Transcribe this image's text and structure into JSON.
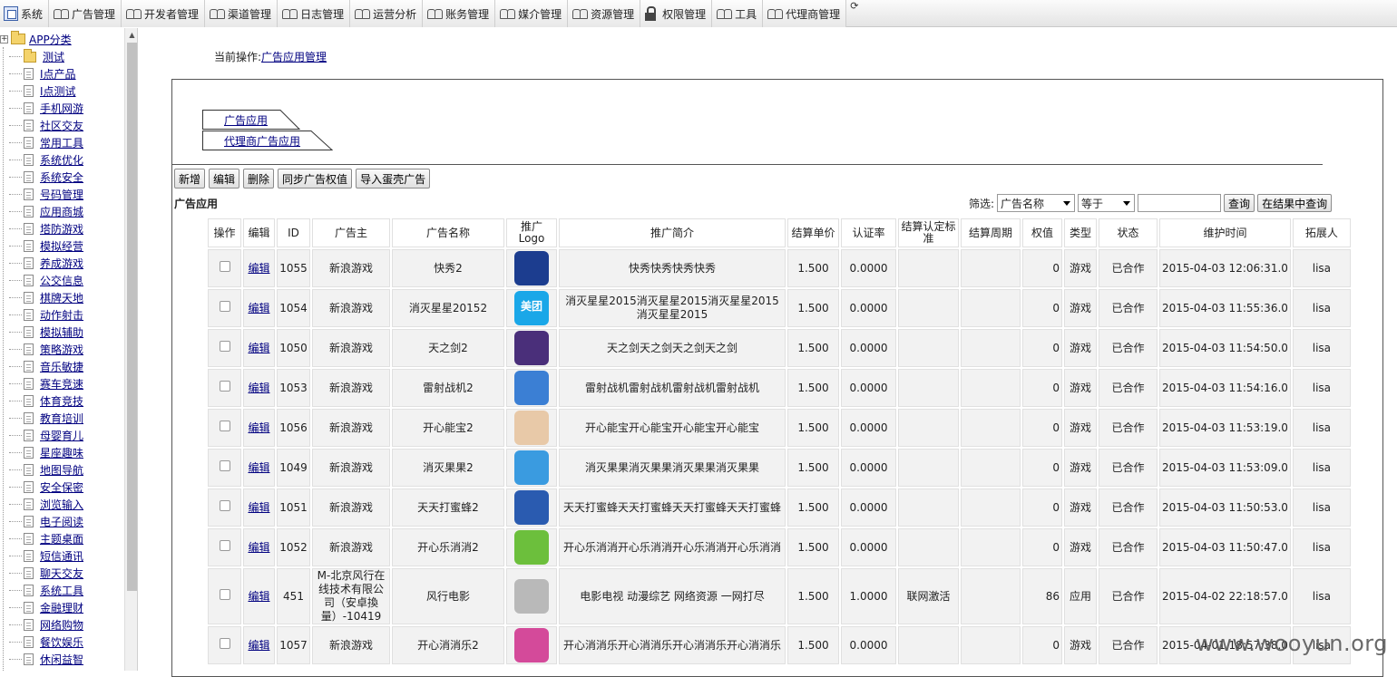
{
  "menu": [
    {
      "label": "系统",
      "icon": "system-icon",
      "kind": "sys"
    },
    {
      "label": "广告管理",
      "icon": "people-icon",
      "kind": "people"
    },
    {
      "label": "开发者管理",
      "icon": "people-icon",
      "kind": "people"
    },
    {
      "label": "渠道管理",
      "icon": "people-icon",
      "kind": "people"
    },
    {
      "label": "日志管理",
      "icon": "people-icon",
      "kind": "people"
    },
    {
      "label": "运营分析",
      "icon": "people-icon",
      "kind": "people"
    },
    {
      "label": "账务管理",
      "icon": "people-icon",
      "kind": "people"
    },
    {
      "label": "媒介管理",
      "icon": "people-icon",
      "kind": "people"
    },
    {
      "label": "资源管理",
      "icon": "people-icon",
      "kind": "people"
    },
    {
      "label": "权限管理",
      "icon": "lock-icon",
      "kind": "lock"
    },
    {
      "label": "工具",
      "icon": "people-icon",
      "kind": "people"
    },
    {
      "label": "代理商管理",
      "icon": "people-icon",
      "kind": "people"
    }
  ],
  "tree": {
    "root_expander": "+",
    "root": "APP分类",
    "items": [
      "测试",
      "I点产品",
      "I点测试",
      "手机网游",
      "社区交友",
      "常用工具",
      "系统优化",
      "系统安全",
      "号码管理",
      "应用商城",
      "塔防游戏",
      "模拟经营",
      "养成游戏",
      "公交信息",
      "棋牌天地",
      "动作射击",
      "模拟辅助",
      "策略游戏",
      "音乐敏捷",
      "赛车竞速",
      "体育竞技",
      "教育培训",
      "母婴育儿",
      "星座趣味",
      "地图导航",
      "安全保密",
      "浏览输入",
      "电子阅读",
      "主题桌面",
      "短信通讯",
      "聊天交友",
      "系统工具",
      "金融理财",
      "网络购物",
      "餐饮娱乐",
      "休闲益智"
    ]
  },
  "breadcrumb": {
    "prefix": "当前操作:",
    "link": "广告应用管理"
  },
  "tabs": [
    "广告应用",
    "代理商广告应用"
  ],
  "toolbar": [
    "新增",
    "编辑",
    "删除",
    "同步广告权值",
    "导入蛋壳广告"
  ],
  "section_title": "广告应用",
  "filter": {
    "label": "筛选:",
    "field": "广告名称",
    "op": "等于",
    "value": "",
    "search": "查询",
    "search_in_results": "在结果中查询"
  },
  "columns": [
    "操作",
    "编辑",
    "ID",
    "广告主",
    "广告名称",
    "推广Logo",
    "推广简介",
    "结算单价",
    "认证率",
    "结算认定标准",
    "结算周期",
    "权值",
    "类型",
    "状态",
    "维护时间",
    "拓展人"
  ],
  "rows": [
    {
      "edit": "编辑",
      "id": "1055",
      "advertiser": "新浪游戏",
      "name": "快秀2",
      "logo": {
        "text": "",
        "color": "#1c3d8f"
      },
      "intro": "快秀快秀快秀快秀",
      "price": "1.500",
      "rate": "0.0000",
      "standard": "",
      "cycle": "",
      "weight": "0",
      "type": "游戏",
      "status": "已合作",
      "time": "2015-04-03 12:06:31.0",
      "owner": "lisa"
    },
    {
      "edit": "编辑",
      "id": "1054",
      "advertiser": "新浪游戏",
      "name": "消灭星星20152",
      "logo": {
        "text": "美团",
        "color": "#1aa7e8"
      },
      "intro": "消灭星星2015消灭星星2015消灭星星2015消灭星星2015",
      "price": "1.500",
      "rate": "0.0000",
      "standard": "",
      "cycle": "",
      "weight": "0",
      "type": "游戏",
      "status": "已合作",
      "time": "2015-04-03 11:55:36.0",
      "owner": "lisa"
    },
    {
      "edit": "编辑",
      "id": "1050",
      "advertiser": "新浪游戏",
      "name": "天之剑2",
      "logo": {
        "text": "",
        "color": "#4a2f7a"
      },
      "intro": "天之剑天之剑天之剑天之剑",
      "price": "1.500",
      "rate": "0.0000",
      "standard": "",
      "cycle": "",
      "weight": "0",
      "type": "游戏",
      "status": "已合作",
      "time": "2015-04-03 11:54:50.0",
      "owner": "lisa"
    },
    {
      "edit": "编辑",
      "id": "1053",
      "advertiser": "新浪游戏",
      "name": "雷射战机2",
      "logo": {
        "text": "",
        "color": "#3b7fd4"
      },
      "intro": "雷射战机雷射战机雷射战机雷射战机",
      "price": "1.500",
      "rate": "0.0000",
      "standard": "",
      "cycle": "",
      "weight": "0",
      "type": "游戏",
      "status": "已合作",
      "time": "2015-04-03 11:54:16.0",
      "owner": "lisa"
    },
    {
      "edit": "编辑",
      "id": "1056",
      "advertiser": "新浪游戏",
      "name": "开心能宝2",
      "logo": {
        "text": "",
        "color": "#e8c9a8"
      },
      "intro": "开心能宝开心能宝开心能宝开心能宝",
      "price": "1.500",
      "rate": "0.0000",
      "standard": "",
      "cycle": "",
      "weight": "0",
      "type": "游戏",
      "status": "已合作",
      "time": "2015-04-03 11:53:19.0",
      "owner": "lisa"
    },
    {
      "edit": "编辑",
      "id": "1049",
      "advertiser": "新浪游戏",
      "name": "消灭果果2",
      "logo": {
        "text": "",
        "color": "#3a9be0"
      },
      "intro": "消灭果果消灭果果消灭果果消灭果果",
      "price": "1.500",
      "rate": "0.0000",
      "standard": "",
      "cycle": "",
      "weight": "0",
      "type": "游戏",
      "status": "已合作",
      "time": "2015-04-03 11:53:09.0",
      "owner": "lisa"
    },
    {
      "edit": "编辑",
      "id": "1051",
      "advertiser": "新浪游戏",
      "name": "天天打蜜蜂2",
      "logo": {
        "text": "",
        "color": "#2a5bb0"
      },
      "intro": "天天打蜜蜂天天打蜜蜂天天打蜜蜂天天打蜜蜂",
      "price": "1.500",
      "rate": "0.0000",
      "standard": "",
      "cycle": "",
      "weight": "0",
      "type": "游戏",
      "status": "已合作",
      "time": "2015-04-03 11:50:53.0",
      "owner": "lisa"
    },
    {
      "edit": "编辑",
      "id": "1052",
      "advertiser": "新浪游戏",
      "name": "开心乐消消2",
      "logo": {
        "text": "",
        "color": "#6cbf3c"
      },
      "intro": "开心乐消消开心乐消消开心乐消消开心乐消消",
      "price": "1.500",
      "rate": "0.0000",
      "standard": "",
      "cycle": "",
      "weight": "0",
      "type": "游戏",
      "status": "已合作",
      "time": "2015-04-03 11:50:47.0",
      "owner": "lisa"
    },
    {
      "edit": "编辑",
      "id": "451",
      "advertiser": "M-北京风行在线技术有限公司（安卓換量）-10419",
      "name": "风行电影",
      "logo": {
        "text": "",
        "color": "#b9b9b9"
      },
      "intro": "电影电视 动漫综艺 网络资源 一网打尽",
      "price": "1.500",
      "rate": "1.0000",
      "standard": "联网激活",
      "cycle": "",
      "weight": "86",
      "type": "应用",
      "status": "已合作",
      "time": "2015-04-02 22:18:57.0",
      "owner": "lisa"
    },
    {
      "edit": "编辑",
      "id": "1057",
      "advertiser": "新浪游戏",
      "name": "开心消消乐2",
      "logo": {
        "text": "",
        "color": "#d44a9a"
      },
      "intro": "开心消消乐开心消消乐开心消消乐开心消消乐",
      "price": "1.500",
      "rate": "0.0000",
      "standard": "",
      "cycle": "",
      "weight": "0",
      "type": "游戏",
      "status": "已合作",
      "time": "2015-04-01 18:57:38.0",
      "owner": "lisa"
    }
  ],
  "watermark": "www.wooyun.org"
}
